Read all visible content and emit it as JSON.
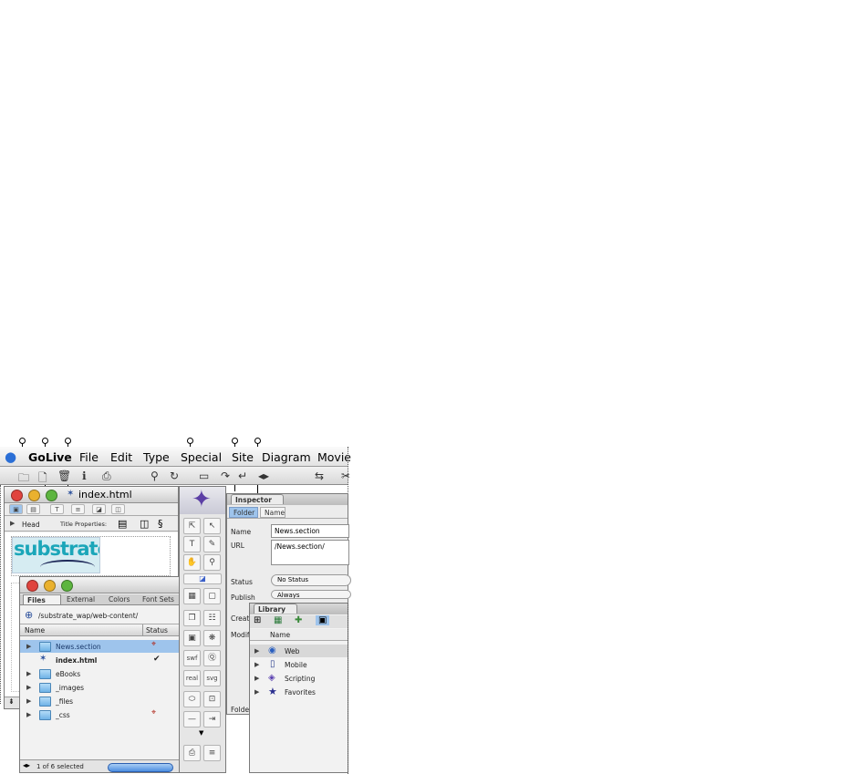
{
  "menubar": {
    "apple": "",
    "items": [
      {
        "label": "GoLive"
      },
      {
        "label": "File"
      },
      {
        "label": "Edit"
      },
      {
        "label": "Type"
      },
      {
        "label": "Special"
      },
      {
        "label": "Site"
      },
      {
        "label": "Diagram"
      },
      {
        "label": "Movie"
      }
    ]
  },
  "document_window": {
    "title": "index.html",
    "head_label": "Head",
    "title_properties_label": "Title Properties:",
    "logo_text": "substrate"
  },
  "site_window": {
    "tabs": [
      "Files",
      "External",
      "Colors",
      "Font Sets"
    ],
    "path": "/substrate_wap/web-content/",
    "columns": [
      "Name",
      "Status"
    ],
    "rows": [
      {
        "name": "News.section",
        "kind": "folder",
        "selected": true,
        "status": "",
        "status_icon": "link-warning-icon"
      },
      {
        "name": "index.html",
        "kind": "page",
        "selected": false,
        "status": "✔",
        "status_icon": ""
      },
      {
        "name": "eBooks",
        "kind": "folder",
        "selected": false,
        "status": "",
        "status_icon": ""
      },
      {
        "name": "_images",
        "kind": "folder",
        "selected": false,
        "status": "",
        "status_icon": ""
      },
      {
        "name": "_files",
        "kind": "folder",
        "selected": false,
        "status": "",
        "status_icon": ""
      },
      {
        "name": "_css",
        "kind": "folder",
        "selected": false,
        "status": "",
        "status_icon": "link-warning-icon"
      }
    ],
    "status_text": "1 of 6 selected"
  },
  "inspector": {
    "title": "Inspector",
    "tabs": [
      "Folder",
      "Name"
    ],
    "name_label": "Name",
    "name_value": "News.section",
    "url_label": "URL",
    "url_value": "/News.section/",
    "status_label": "Status",
    "status_value": "No Status",
    "publish_label": "Publish",
    "publish_value": "Always",
    "created_label": "Creat",
    "modified_label": "Modif",
    "folder_label": "Folde"
  },
  "library": {
    "title": "Library",
    "column": "Name",
    "items": [
      {
        "label": "Web",
        "selected": true,
        "icon": "globe-icon"
      },
      {
        "label": "Mobile",
        "selected": false,
        "icon": "phone-icon"
      },
      {
        "label": "Scripting",
        "selected": false,
        "icon": "script-icon"
      },
      {
        "label": "Favorites",
        "selected": false,
        "icon": "star-icon"
      }
    ]
  },
  "colors": {
    "selection": "#9ec4ec",
    "library_selection": "#d8d8d8",
    "folder_blue": "#6fb2e6",
    "progress_blue": "#4d8fe0"
  }
}
